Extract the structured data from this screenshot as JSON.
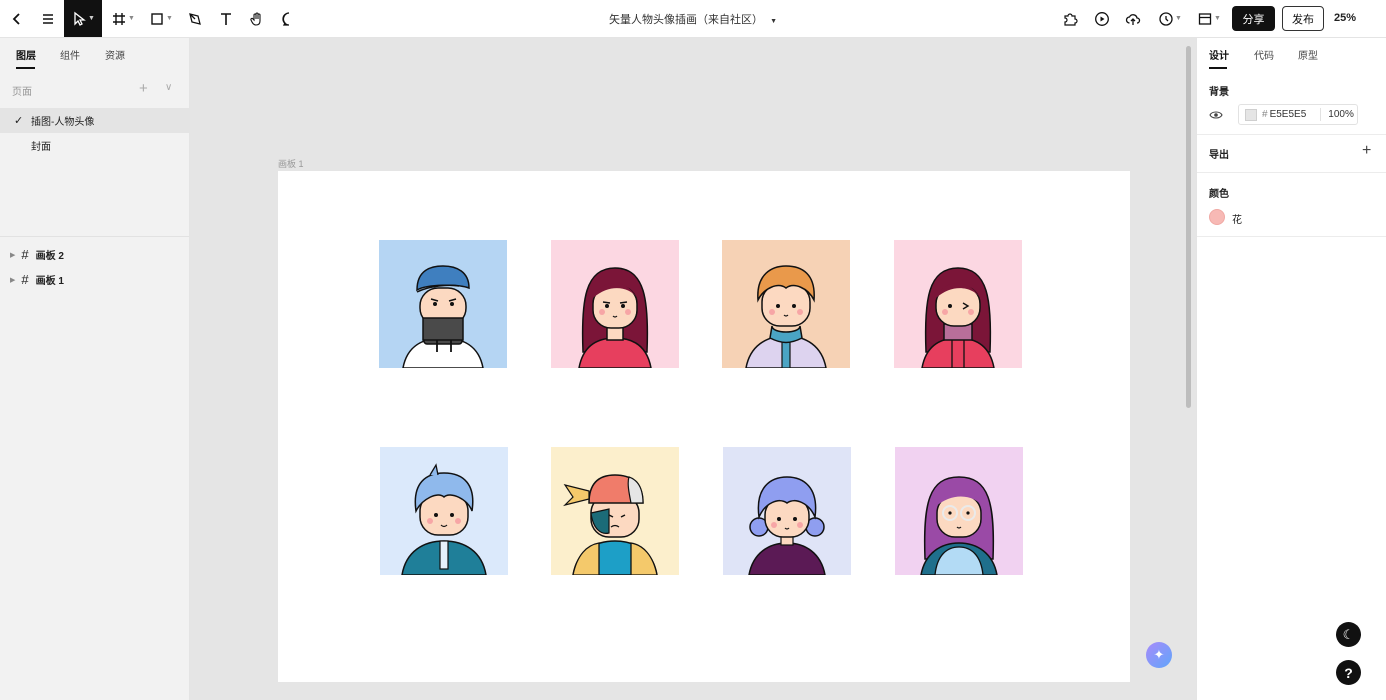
{
  "toolbar": {
    "title": "矢量人物头像插画（来自社区）",
    "share": "分享",
    "publish": "发布",
    "zoom": "25%"
  },
  "left": {
    "tabs": [
      "图层",
      "组件",
      "资源"
    ],
    "pages_header": "页面",
    "pages": [
      "插图-人物头像",
      "封面"
    ],
    "layers": [
      "画板 2",
      "画板 1"
    ]
  },
  "right": {
    "tabs": [
      "设计",
      "代码",
      "原型"
    ],
    "background_title": "背景",
    "bg_hex": "E5E5E5",
    "bg_opacity": "100%",
    "export_title": "导出",
    "colors_title": "颜色",
    "color_name": "花"
  },
  "canvas": {
    "artboard_label": "画板 1"
  },
  "colors": {
    "accent": "#111111",
    "canvas_bg": "#E5E5E5",
    "color_swatch": "#F7B9B5"
  }
}
